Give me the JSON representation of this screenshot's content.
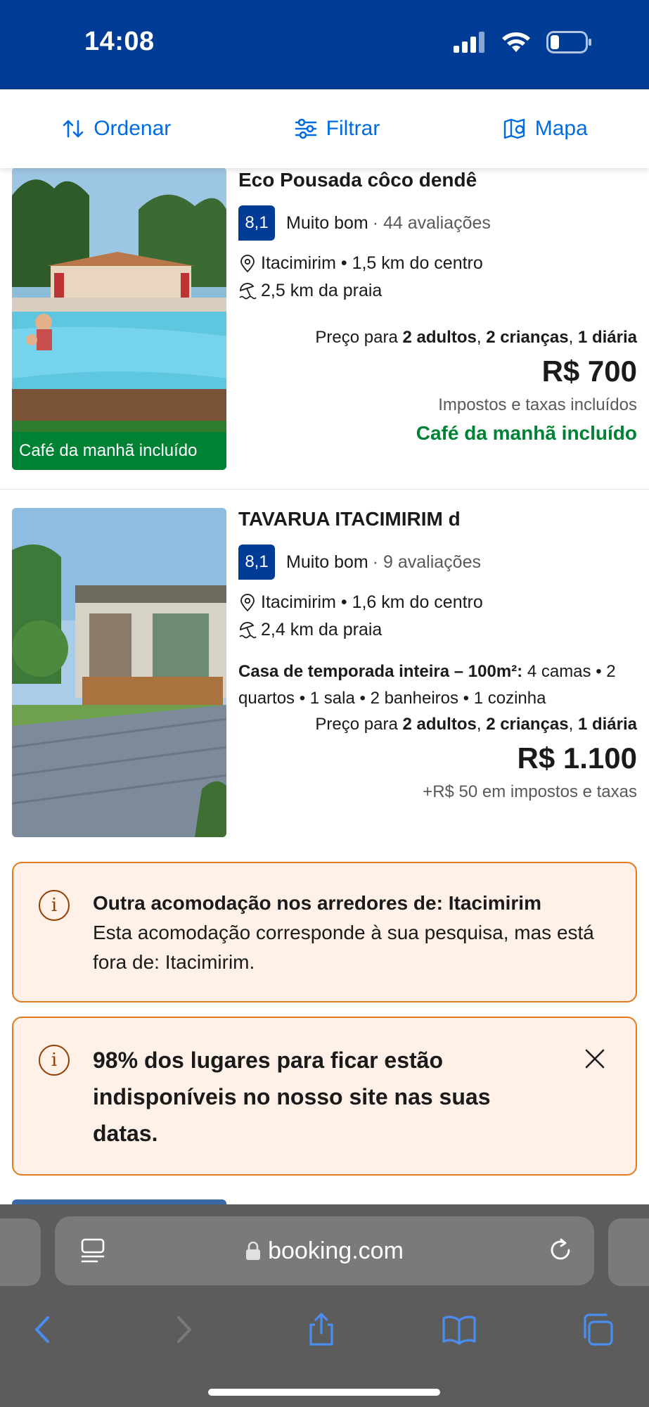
{
  "status_bar": {
    "time": "14:08"
  },
  "toolbar": {
    "sort_label": "Ordenar",
    "filter_label": "Filtrar",
    "map_label": "Mapa"
  },
  "properties": [
    {
      "name": "Eco Pousada côco dendê",
      "score": "8,1",
      "rating_word": "Muito bom",
      "reviews": "· 44 avaliações",
      "location": "Itacimirim • 1,5 km do centro",
      "beach": "2,5 km da praia",
      "price_for_prefix": "Preço para",
      "price_for_adults": "2 adultos",
      "price_for_children": "2 crianças",
      "price_for_nights": "1 diária",
      "price": "R$ 700",
      "taxes": "Impostos e taxas incluídos",
      "breakfast_badge": "Café da manhã incluído",
      "breakfast_text": "Café da manhã incluído"
    },
    {
      "name": "TAVARUA ITACIMIRIM d",
      "score": "8,1",
      "rating_word": "Muito bom",
      "reviews": "· 9 avaliações",
      "location": "Itacimirim • 1,6 km do centro",
      "beach": "2,4 km da praia",
      "desc_bold": "Casa de temporada inteira – 100m²:",
      "desc_rest": " 4 camas • 2 quartos • 1 sala • 2 banheiros • 1 cozinha",
      "price_for_prefix": "Preço para",
      "price_for_adults": "2 adultos",
      "price_for_children": "2 crianças",
      "price_for_nights": "1 diária",
      "price": "R$ 1.100",
      "taxes": "+R$ 50 em impostos e taxas"
    }
  ],
  "notices": [
    {
      "title": "Outra acomodação nos arredores de: Itacimirim",
      "body": "Esta acomodação corresponde à sua pesquisa, mas está fora de: Itacimirim."
    },
    {
      "title": "98% dos lugares para ficar estão indisponíveis no nosso site nas suas datas."
    }
  ],
  "browser": {
    "url": "booking.com"
  },
  "colors": {
    "brand_blue": "#003b95",
    "link_blue": "#006ce4",
    "green": "#008234",
    "notice_bg": "#fff0e8",
    "notice_border": "#e07b22"
  }
}
